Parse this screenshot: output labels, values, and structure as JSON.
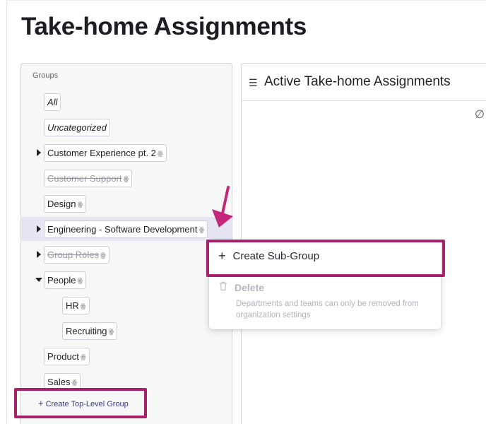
{
  "page": {
    "title": "Take-home Assignments"
  },
  "groups": {
    "heading": "Groups",
    "items": [
      {
        "label": "All",
        "team_icon": false
      },
      {
        "label": "Uncategorized",
        "team_icon": false
      },
      {
        "label": "Customer Experience pt. 2",
        "team_icon": true
      },
      {
        "label": "Customer Support",
        "team_icon": true
      },
      {
        "label": "Design",
        "team_icon": true
      },
      {
        "label": "Engineering - Software Development",
        "team_icon": true
      },
      {
        "label": "Group Roles",
        "team_icon": true
      },
      {
        "label": "People",
        "team_icon": true
      },
      {
        "label": "HR",
        "team_icon": true
      },
      {
        "label": "Recruiting",
        "team_icon": true
      },
      {
        "label": "Product",
        "team_icon": true
      },
      {
        "label": "Sales",
        "team_icon": true
      }
    ],
    "create_top_level": {
      "plus": "+",
      "label": "Create Top-Level Group"
    }
  },
  "assignments": {
    "list_icon": "list-icon",
    "title": "Active Take-home Assignments",
    "empty_icon": "empty-set-icon"
  },
  "context_menu": {
    "create_sub_group": {
      "plus": "+",
      "label": "Create Sub-Group"
    },
    "delete": {
      "icon": "trash-icon",
      "label": "Delete",
      "note": "Departments and teams can only be removed from organization settings"
    }
  },
  "icons": {
    "team": "team-icon",
    "list": "☰",
    "empty": "∅",
    "trash": "🗑"
  },
  "colors": {
    "accent": "#a8226b",
    "selected_row": "#e7e5f4",
    "link": "#3c3a8c",
    "panel_bg": "#f7f7f8"
  }
}
